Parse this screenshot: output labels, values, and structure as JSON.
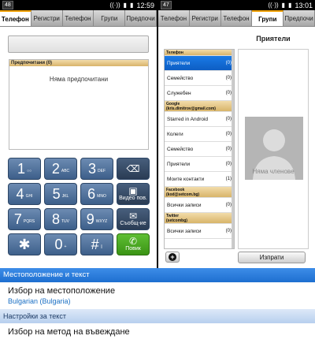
{
  "left": {
    "status": {
      "badge": "48",
      "time": "12:59"
    },
    "tabs": [
      "Телефон",
      "Регистри",
      "Телефон",
      "Групи",
      "Предпочи"
    ],
    "favorites": {
      "header": "Предпочитани (0)",
      "empty": "Няма предпочитани"
    },
    "keys": [
      {
        "digit": "1",
        "letters": "○○"
      },
      {
        "digit": "2",
        "letters": "ABC"
      },
      {
        "digit": "3",
        "letters": "DEF"
      },
      {
        "digit": "4",
        "letters": "GHI"
      },
      {
        "digit": "5",
        "letters": "JKL"
      },
      {
        "digit": "6",
        "letters": "MNO"
      },
      {
        "digit": "7",
        "letters": "PQRS"
      },
      {
        "digit": "8",
        "letters": "TUV"
      },
      {
        "digit": "9",
        "letters": "WXYZ"
      },
      {
        "digit": "✱",
        "letters": ""
      },
      {
        "digit": "0",
        "letters": "+"
      },
      {
        "digit": "#",
        "letters": ""
      }
    ],
    "video_call": "Видео пов.",
    "message": "Съобщ-ие",
    "call": "Повик"
  },
  "right": {
    "status": {
      "badge": "47",
      "time": "13:01"
    },
    "tabs": [
      "Телефон",
      "Регистри",
      "Телефон",
      "Групи",
      "Предпочи"
    ],
    "group_title": "Приятели",
    "list": [
      {
        "type": "h",
        "name": "Телефон"
      },
      {
        "type": "item",
        "name": "Приятели",
        "count": "(0)",
        "selected": true
      },
      {
        "type": "item",
        "name": "Семейство",
        "count": "(0)"
      },
      {
        "type": "item",
        "name": "Служебен",
        "count": "(0)"
      },
      {
        "type": "h2",
        "name": "Google",
        "sub": "(kris.dimitrov@gmail.com)"
      },
      {
        "type": "item",
        "name": "Starred in Android",
        "count": "(0)"
      },
      {
        "type": "item",
        "name": "Колеги",
        "count": "(0)"
      },
      {
        "type": "item",
        "name": "Семейство",
        "count": "(0)"
      },
      {
        "type": "item",
        "name": "Приятели",
        "count": "(0)"
      },
      {
        "type": "item",
        "name": "Моите контакти",
        "count": "(1)"
      },
      {
        "type": "h2",
        "name": "Facebook",
        "sub": "(kod@setcom.bg)"
      },
      {
        "type": "item",
        "name": "Всички записи",
        "count": "(0)"
      },
      {
        "type": "h2",
        "name": "Twitter",
        "sub": "(setcombg)"
      },
      {
        "type": "item",
        "name": "Всички записи",
        "count": "(0)"
      }
    ],
    "no_members": "Няма членове",
    "send": "Изпрати"
  },
  "settings": {
    "section1": "Местоположение и текст",
    "item1_title": "Избор на местоположение",
    "item1_sub": "Bulgarian (Bulgaria)",
    "section2": "Настройки за текст",
    "item2_title": "Избор на метод на въвеждане"
  }
}
